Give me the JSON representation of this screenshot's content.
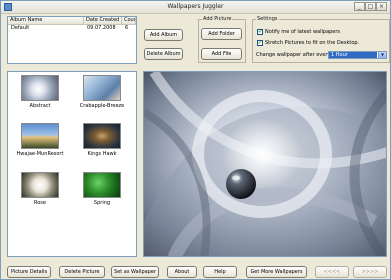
{
  "window": {
    "title": "Wallpapers Juggler",
    "minimize": "_",
    "maximize": "□",
    "close": "×"
  },
  "albums": {
    "columns": [
      "Album Name",
      "Date Created",
      "Count"
    ],
    "rows": [
      {
        "name": "Default",
        "date": "09.07.2008",
        "count": "6"
      }
    ],
    "add_button": "Add Album",
    "delete_button": "Delete Album"
  },
  "add_picture": {
    "legend": "Add Picture",
    "add_folder": "Add Folder",
    "add_file": "Add File"
  },
  "settings": {
    "legend": "Settings",
    "notify_label": "Notify me of latest wallpapers",
    "notify_checked": true,
    "stretch_label": "Stretch Pictures to fit on the Desktop.",
    "stretch_checked": true,
    "change_label": "Change wallpaper after every",
    "interval_value": "1 Hour"
  },
  "thumbnails": [
    {
      "label": "Abstract"
    },
    {
      "label": "Crabapple-Breeze"
    },
    {
      "label": "Hwajae-MunResort"
    },
    {
      "label": "Kings Hawk"
    },
    {
      "label": "Rose"
    },
    {
      "label": "Spring"
    }
  ],
  "bottom": {
    "picture_details": "Picture Details",
    "delete_picture": "Delete Picture",
    "set_as_wallpaper": "Set as Wallpaper",
    "about": "About",
    "help": "Help",
    "get_more": "Get More Wallpapers",
    "prev": "<<<<",
    "next": ">>>>"
  }
}
